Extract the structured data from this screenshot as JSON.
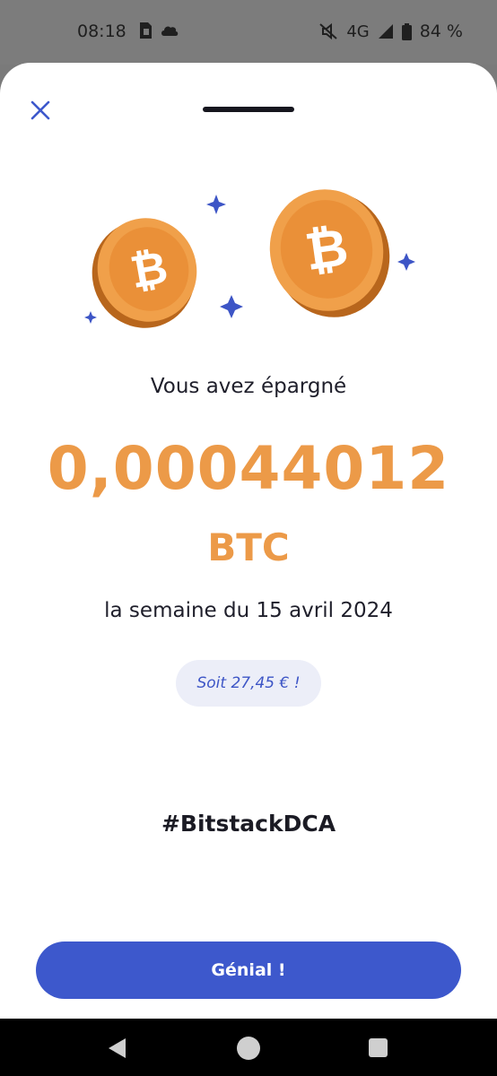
{
  "status_bar": {
    "time": "08:18",
    "network": "4G",
    "battery": "84 %",
    "icons": [
      "sim-card-icon",
      "cloud-icon",
      "mute-icon",
      "signal-icon",
      "battery-icon"
    ]
  },
  "sheet": {
    "close_icon": "close-icon",
    "saved_label": "Vous avez épargné",
    "amount": "0,00044012",
    "unit": "BTC",
    "week_label": "la semaine du 15 avril 2024",
    "eur_badge": "Soit 27,45 € !",
    "hashtag": "#BitstackDCA",
    "cta_label": "Génial !"
  },
  "illustration": {
    "coin_symbol": "₿",
    "icons": [
      "bitcoin-coin-icon",
      "bitcoin-coin-icon",
      "sparkle-icon"
    ]
  },
  "colors": {
    "accent_orange": "#ec9a48",
    "brand_blue": "#3d58cc",
    "badge_bg": "#eceef8"
  },
  "nav_bar": {
    "icons": [
      "back-icon",
      "home-icon",
      "recents-icon"
    ]
  }
}
